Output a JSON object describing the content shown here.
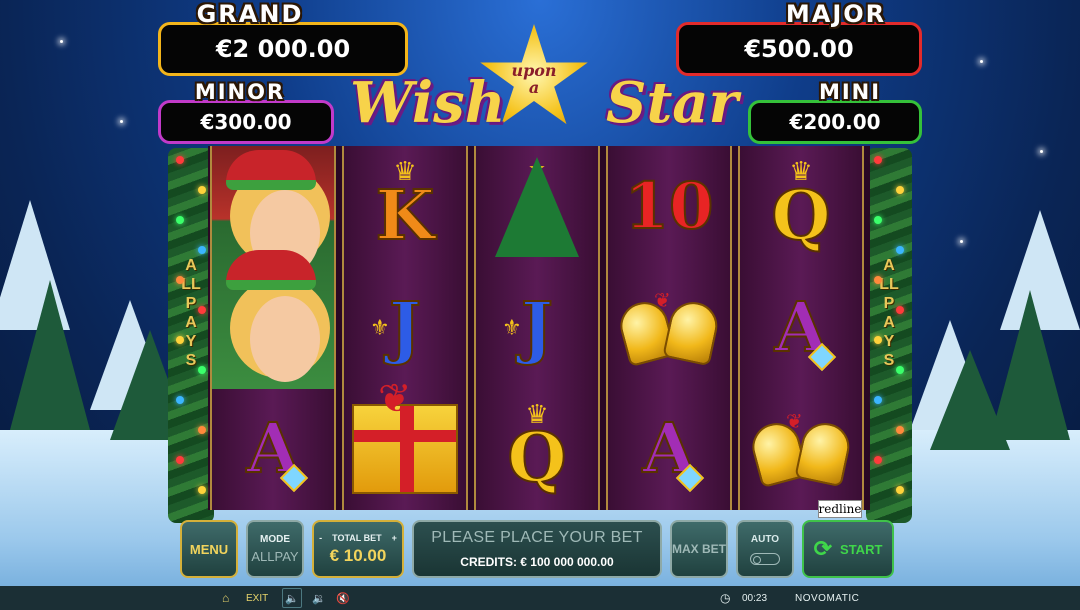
{
  "jackpots": {
    "grand": {
      "title": "GRAND",
      "value": "€2 000.00"
    },
    "major": {
      "title": "MAJOR",
      "value": "€500.00"
    },
    "minor": {
      "title": "MINOR",
      "value": "€300.00"
    },
    "mini": {
      "title": "MINI",
      "value": "€200.00"
    }
  },
  "logo": {
    "word1": "Wish",
    "word2": "upon a",
    "word3": "Star"
  },
  "side_label": "ALLPAYS",
  "reels": [
    [
      "elf",
      "elf",
      "A"
    ],
    [
      "K",
      "J",
      "gift"
    ],
    [
      "tree",
      "J",
      "Q"
    ],
    [
      "10",
      "bells",
      "A"
    ],
    [
      "Q",
      "A",
      "bells"
    ]
  ],
  "symbols": {
    "K": "K",
    "J": "J",
    "Q": "Q",
    "A": "A",
    "ten": "10"
  },
  "provider_badge": "redline",
  "controls": {
    "menu": "MENU",
    "mode_label": "MODE",
    "mode_value": "ALLPAY",
    "total_bet_label": "TOTAL BET",
    "bet_minus": "-",
    "bet_plus": "+",
    "total_bet_value": "€ 10.00",
    "message": "PLEASE PLACE YOUR BET",
    "credits": "CREDITS: € 100 000 000.00",
    "max_bet": "MAX BET",
    "auto": "AUTO",
    "start": "START"
  },
  "statusbar": {
    "exit": "EXIT",
    "time": "00:23",
    "brand": "NOVOMATIC"
  },
  "icons": {
    "home": "home-icon",
    "speaker": "speaker-icon",
    "volume": "volume-icon",
    "mute": "mute-icon",
    "clock": "clock-icon",
    "start": "refresh-icon"
  },
  "colors": {
    "grand_border": "#f3b51b",
    "major_border": "#e32b2b",
    "minor_border": "#c13ac9",
    "mini_border": "#35c13a",
    "start_green": "#3fd64a"
  }
}
